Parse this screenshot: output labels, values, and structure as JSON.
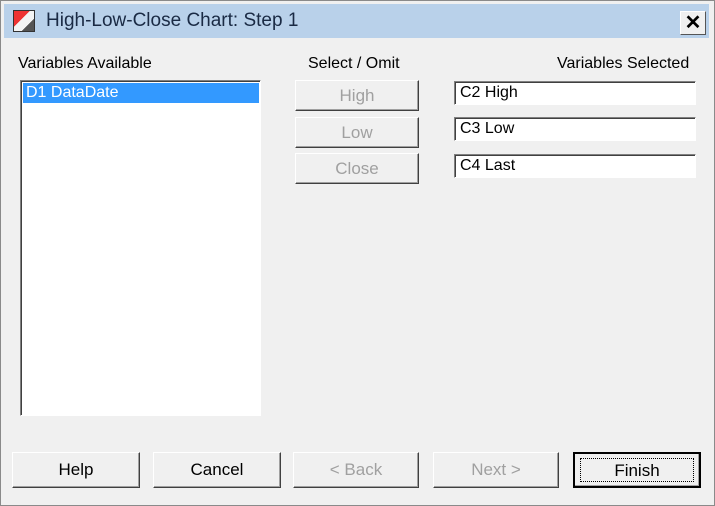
{
  "window": {
    "title": "High-Low-Close Chart: Step 1",
    "icon": "chart-app-icon",
    "close_glyph": "✕"
  },
  "available": {
    "heading": "Variables Available",
    "items": [
      "D1 DataDate"
    ],
    "selected_index": 0
  },
  "select_omit": {
    "heading": "Select / Omit",
    "buttons": [
      {
        "label": "High",
        "mnemonic": "H",
        "enabled": false
      },
      {
        "label": "Low",
        "mnemonic": "w",
        "enabled": false
      },
      {
        "label": "Close",
        "mnemonic": "C",
        "enabled": false
      }
    ]
  },
  "selected": {
    "heading": "Variables Selected",
    "fields": [
      "C2 High",
      "C3 Low",
      "C4 Last"
    ]
  },
  "footer": {
    "help": "Help",
    "cancel": "Cancel",
    "back": "< Back",
    "next": "Next >",
    "finish": "Finish"
  }
}
